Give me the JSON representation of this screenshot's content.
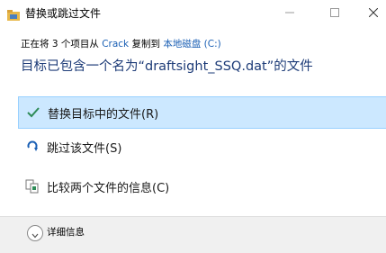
{
  "window": {
    "title": "替换或跳过文件"
  },
  "progress": {
    "prefix": "正在将 3 个项目从 ",
    "source": "Crack",
    "middle": " 复制到 ",
    "destination": "本地磁盘 (C:)"
  },
  "heading": "目标已包含一个名为“draftsight_SSQ.dat”的文件",
  "options": {
    "replace": {
      "label": "替换目标中的文件(R)",
      "icon": "checkmark-icon"
    },
    "skip": {
      "label": "跳过该文件(S)",
      "icon": "skip-arrow-icon"
    },
    "compare": {
      "label": "比较两个文件的信息(C)",
      "icon": "compare-files-icon"
    }
  },
  "footer": {
    "details_label": "详细信息",
    "icon": "chevron-down-icon"
  },
  "colors": {
    "accent": "#1a5fb4",
    "selected_bg": "#cce8ff",
    "selected_border": "#99d1ff",
    "heading": "#1e3c78",
    "check": "#2e8b57"
  }
}
